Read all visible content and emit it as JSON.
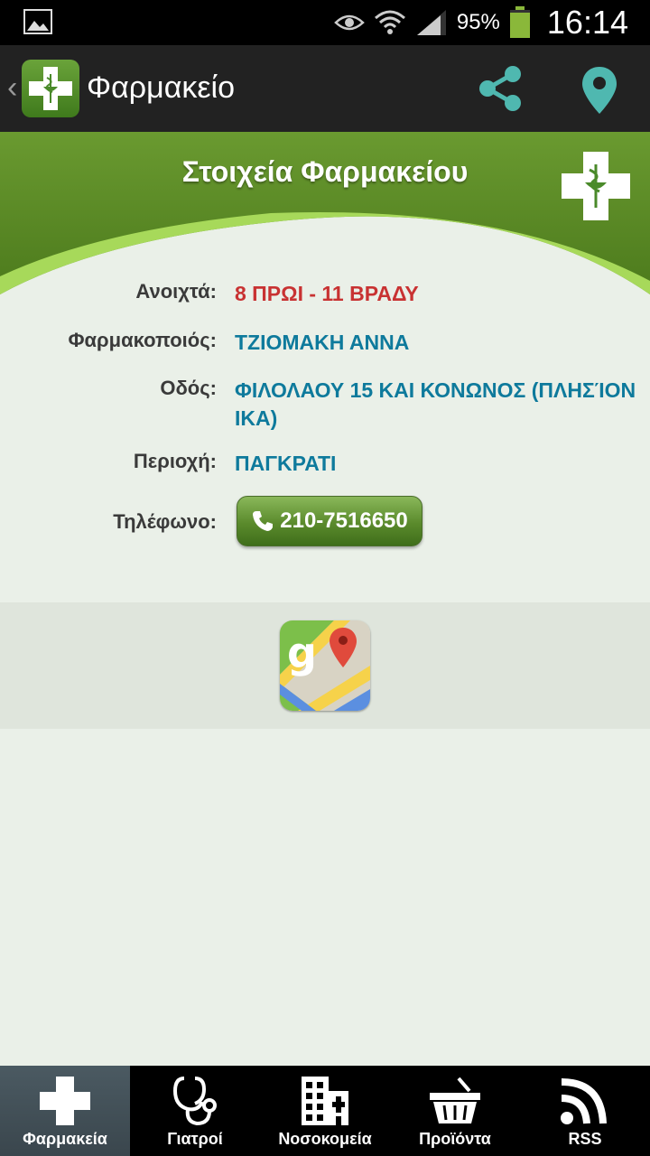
{
  "status_bar": {
    "battery_percent": "95%",
    "time": "16:14"
  },
  "action_bar": {
    "title": "Φαρμακείο"
  },
  "header": {
    "title": "Στοιχεία Φαρμακείου"
  },
  "details": [
    {
      "label": "Ανοιχτά:",
      "value": "8 ΠΡΩΙ - 11 ΒΡΑΔΥ"
    },
    {
      "label": "Φαρμακοποιός:",
      "value": "ΤΖΙΟΜΑΚΗ ΑΝΝΑ"
    },
    {
      "label": "Οδός:",
      "value": "ΦΙΛΟΛΑΟΥ 15 ΚΑΙ ΚΟΝΩΝΟΣ (ΠΛΗΣΊΟΝ ΙΚΑ)"
    },
    {
      "label": "Περιοχή:",
      "value": "ΠΑΓΚΡΑΤΙ"
    },
    {
      "label": "Τηλέφωνο:",
      "value": "210-7516650"
    }
  ],
  "bottom_nav": [
    {
      "label": "Φαρμακεία",
      "icon": "cross-icon",
      "active": true
    },
    {
      "label": "Γιατροί",
      "icon": "stethoscope-icon",
      "active": false
    },
    {
      "label": "Νοσοκομεία",
      "icon": "hospital-building-icon",
      "active": false
    },
    {
      "label": "Προϊόντα",
      "icon": "basket-icon",
      "active": false
    },
    {
      "label": "RSS",
      "icon": "rss-icon",
      "active": false
    }
  ],
  "colors": {
    "accent_green": "#6a9a2e",
    "value_blue": "#0e7a9c",
    "hours_red": "#c83232",
    "share_teal": "#4fb8b0"
  }
}
